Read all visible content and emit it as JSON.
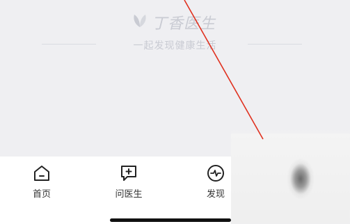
{
  "watermark": {
    "brand_name": "丁香医生",
    "slogan": "一起发现健康生活",
    "logo_icon": "clove-leaf-icon"
  },
  "tab_bar": {
    "tabs": [
      {
        "label": "首页",
        "icon": "home-icon"
      },
      {
        "label": "问医生",
        "icon": "chat-plus-icon"
      },
      {
        "label": "发现",
        "icon": "pulse-circle-icon"
      }
    ]
  },
  "colors": {
    "background": "#efeff2",
    "tab_bar_bg": "#ffffff",
    "watermark": "#c9cbd3",
    "annotation_line": "#e0301e",
    "tab_text": "#333333"
  }
}
